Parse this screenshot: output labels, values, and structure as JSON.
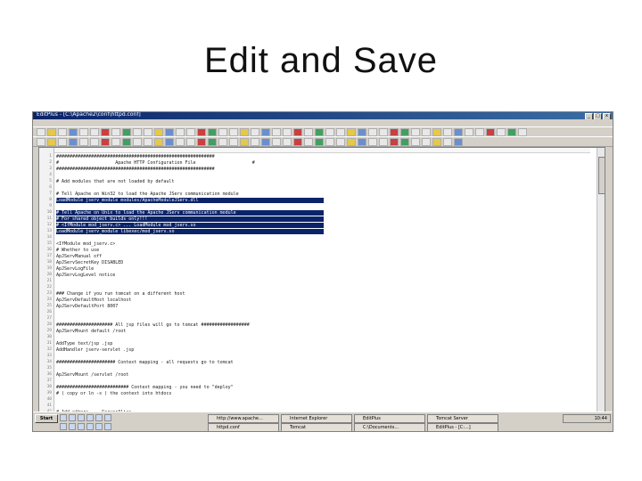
{
  "slide": {
    "title": "Edit and Save"
  },
  "window": {
    "title": "EditPlus - [C:\\Apache2\\conf\\httpd.conf]",
    "menu_count": 10,
    "controls": [
      "_",
      "□",
      "x"
    ]
  },
  "editor": {
    "lines": [
      {
        "n": "1",
        "text": "###########################################################",
        "sel": false
      },
      {
        "n": "2",
        "text": "#                     Apache HTTP Configuration File                     #",
        "sel": false
      },
      {
        "n": "3",
        "text": "###########################################################",
        "sel": false
      },
      {
        "n": "4",
        "text": "",
        "sel": false
      },
      {
        "n": "5",
        "text": "# Add modules that are not loaded by default",
        "sel": false
      },
      {
        "n": "6",
        "text": "",
        "sel": false
      },
      {
        "n": "7",
        "text": "# Tell Apache on Win32 to load the Apache JServ communication module",
        "sel": false
      },
      {
        "n": "8",
        "text": "LoadModule jserv_module modules/ApacheModuleJServ.dll",
        "sel": true
      },
      {
        "n": "9",
        "text": "",
        "sel": false
      },
      {
        "n": "10",
        "text": "# Tell Apache on Unix to load the Apache JServ communication module",
        "sel": true
      },
      {
        "n": "11",
        "text": "# For shared object builds only!!!",
        "sel": true
      },
      {
        "n": "12",
        "text": "# <IfModule mod_jserv.c> ... LoadModule mod_jserv.so",
        "sel": true
      },
      {
        "n": "13",
        "text": "LoadModule jserv_module libexec/mod_jserv.so",
        "sel": true
      },
      {
        "n": "14",
        "text": "",
        "sel": false
      },
      {
        "n": "15",
        "text": "<IfModule mod_jserv.c>",
        "sel": false
      },
      {
        "n": "16",
        "text": "# Whether to use",
        "sel": false
      },
      {
        "n": "17",
        "text": "ApJServManual off",
        "sel": false
      },
      {
        "n": "18",
        "text": "ApJServSecretKey DISABLED",
        "sel": false
      },
      {
        "n": "19",
        "text": "ApJServLogFile",
        "sel": false
      },
      {
        "n": "20",
        "text": "ApJServLogLevel notice",
        "sel": false
      },
      {
        "n": "21",
        "text": "",
        "sel": false
      },
      {
        "n": "22",
        "text": "",
        "sel": false
      },
      {
        "n": "23",
        "text": "### Change if you run tomcat on a different host",
        "sel": false
      },
      {
        "n": "24",
        "text": "ApJServDefaultHost localhost",
        "sel": false
      },
      {
        "n": "25",
        "text": "ApJServDefaultPort 8007",
        "sel": false
      },
      {
        "n": "26",
        "text": "",
        "sel": false
      },
      {
        "n": "27",
        "text": "",
        "sel": false
      },
      {
        "n": "28",
        "text": "##################### All jsp files will go to tomcat ##################",
        "sel": false
      },
      {
        "n": "29",
        "text": "ApJServMount default /root",
        "sel": false
      },
      {
        "n": "30",
        "text": "",
        "sel": false
      },
      {
        "n": "31",
        "text": "AddType text/jsp .jsp",
        "sel": false
      },
      {
        "n": "32",
        "text": "AddHandler jserv-servlet .jsp",
        "sel": false
      },
      {
        "n": "33",
        "text": "",
        "sel": false
      },
      {
        "n": "34",
        "text": "###################### Context mapping - all requests go to tomcat",
        "sel": false
      },
      {
        "n": "35",
        "text": "",
        "sel": false
      },
      {
        "n": "36",
        "text": "ApJServMount /servlet /root",
        "sel": false
      },
      {
        "n": "37",
        "text": "",
        "sel": false
      },
      {
        "n": "38",
        "text": "########################### Context mapping - you need to \"deploy\"",
        "sel": false
      },
      {
        "n": "39",
        "text": "# ( copy or ln -s ) the context into htdocs",
        "sel": false
      },
      {
        "n": "40",
        "text": "",
        "sel": false
      },
      {
        "n": "41",
        "text": "",
        "sel": false
      },
      {
        "n": "42",
        "text": "# Add others...  ServerAlias ...",
        "sel": false
      }
    ]
  },
  "taskbar": {
    "start_label": "Start",
    "buttons": [
      {
        "label": "http://www.apache..."
      },
      {
        "label": "httpd.conf"
      },
      {
        "label": "Internet Explorer"
      },
      {
        "label": "Tomcat"
      },
      {
        "label": "EditPlus"
      },
      {
        "label": "C:\\Documents..."
      },
      {
        "label": "Tomcat Server"
      },
      {
        "label": "EditPlus - [C:...]"
      }
    ],
    "clock": "10:44"
  }
}
